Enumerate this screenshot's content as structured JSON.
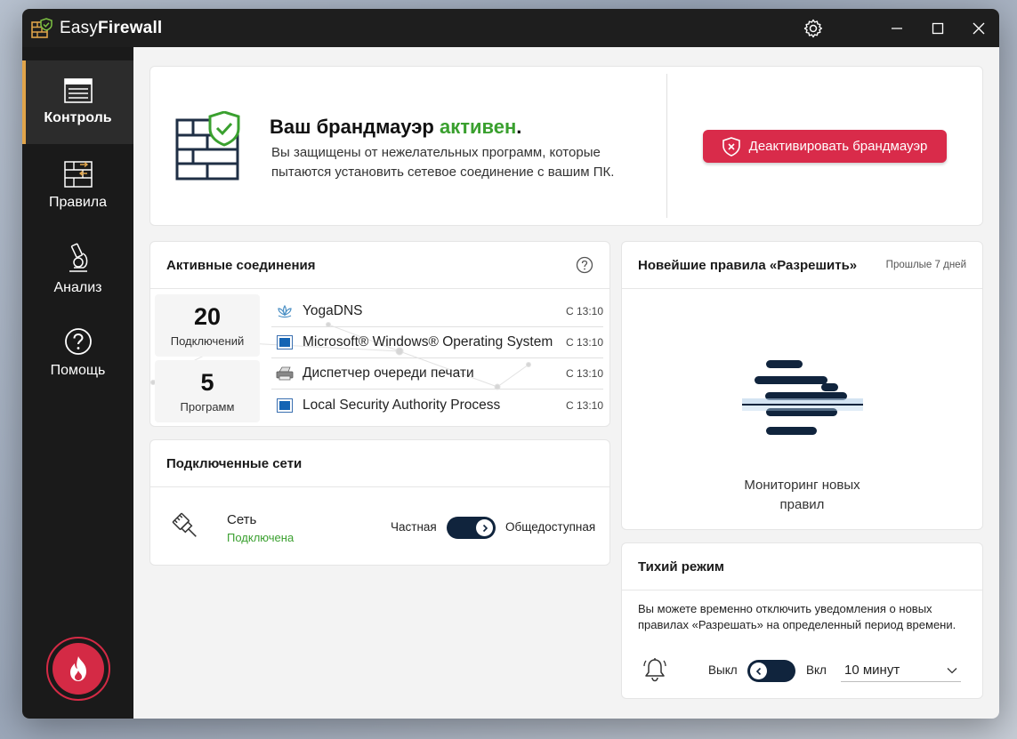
{
  "titlebar": {
    "title_regular": "Easy",
    "title_bold": "Firewall",
    "icons": [
      "firewall-logo-icon",
      "gear-icon",
      "minimize-icon",
      "maximize-icon",
      "close-icon"
    ]
  },
  "sidebar": {
    "items": [
      {
        "label": "Контроль",
        "icon": "control-panel-icon",
        "active": true
      },
      {
        "label": "Правила",
        "icon": "rules-icon",
        "active": false
      },
      {
        "label": "Анализ",
        "icon": "microscope-icon",
        "active": false
      },
      {
        "label": "Помощь",
        "icon": "help-circle-icon",
        "active": false
      }
    ],
    "fire_button_icon": "flame-icon"
  },
  "status": {
    "title_prefix": "Ваш брандмауэр ",
    "title_state": "активен",
    "title_suffix": ".",
    "description": "Вы защищены от нежелательных программ, которые пытаются установить сетевое соединение с вашим ПК.",
    "deactivate_label": "Деактивировать брандмауэр"
  },
  "connections": {
    "title": "Активные соединения",
    "stats": [
      {
        "value": "20",
        "label": "Подключений"
      },
      {
        "value": "5",
        "label": "Программ"
      }
    ],
    "rows": [
      {
        "name": "YogaDNS",
        "time": "С 13:10",
        "icon": "lotus-icon"
      },
      {
        "name": "Microsoft® Windows® Operating System",
        "time": "С 13:10",
        "icon": "window-app-icon"
      },
      {
        "name": "Диспетчер очереди печати",
        "time": "С 13:10",
        "icon": "printer-icon"
      },
      {
        "name": "Local Security Authority Process",
        "time": "С 13:10",
        "icon": "window-app-icon"
      }
    ]
  },
  "networks": {
    "title": "Подключенные сети",
    "name": "Сеть",
    "status": "Подключена",
    "private_label": "Частная",
    "public_label": "Общедоступная",
    "toggle_state": "on"
  },
  "rules": {
    "title": "Новейшие правила «Разрешить»",
    "period": "Прошлые 7 дней",
    "message_line1": "Мониторинг новых",
    "message_line2": "правил"
  },
  "quiet": {
    "title": "Тихий режим",
    "description": "Вы можете временно отключить уведомления о новых правилах «Разрешать» на определенный период времени.",
    "off_label": "Выкл",
    "on_label": "Вкл",
    "toggle_state": "off",
    "duration": "10 минут"
  },
  "colors": {
    "accent_green": "#3aa02f",
    "danger_red": "#d92b4a",
    "toggle_navy": "#10243d",
    "sidebar_bg": "#1a1a1a",
    "active_indicator": "#e0a44a"
  }
}
